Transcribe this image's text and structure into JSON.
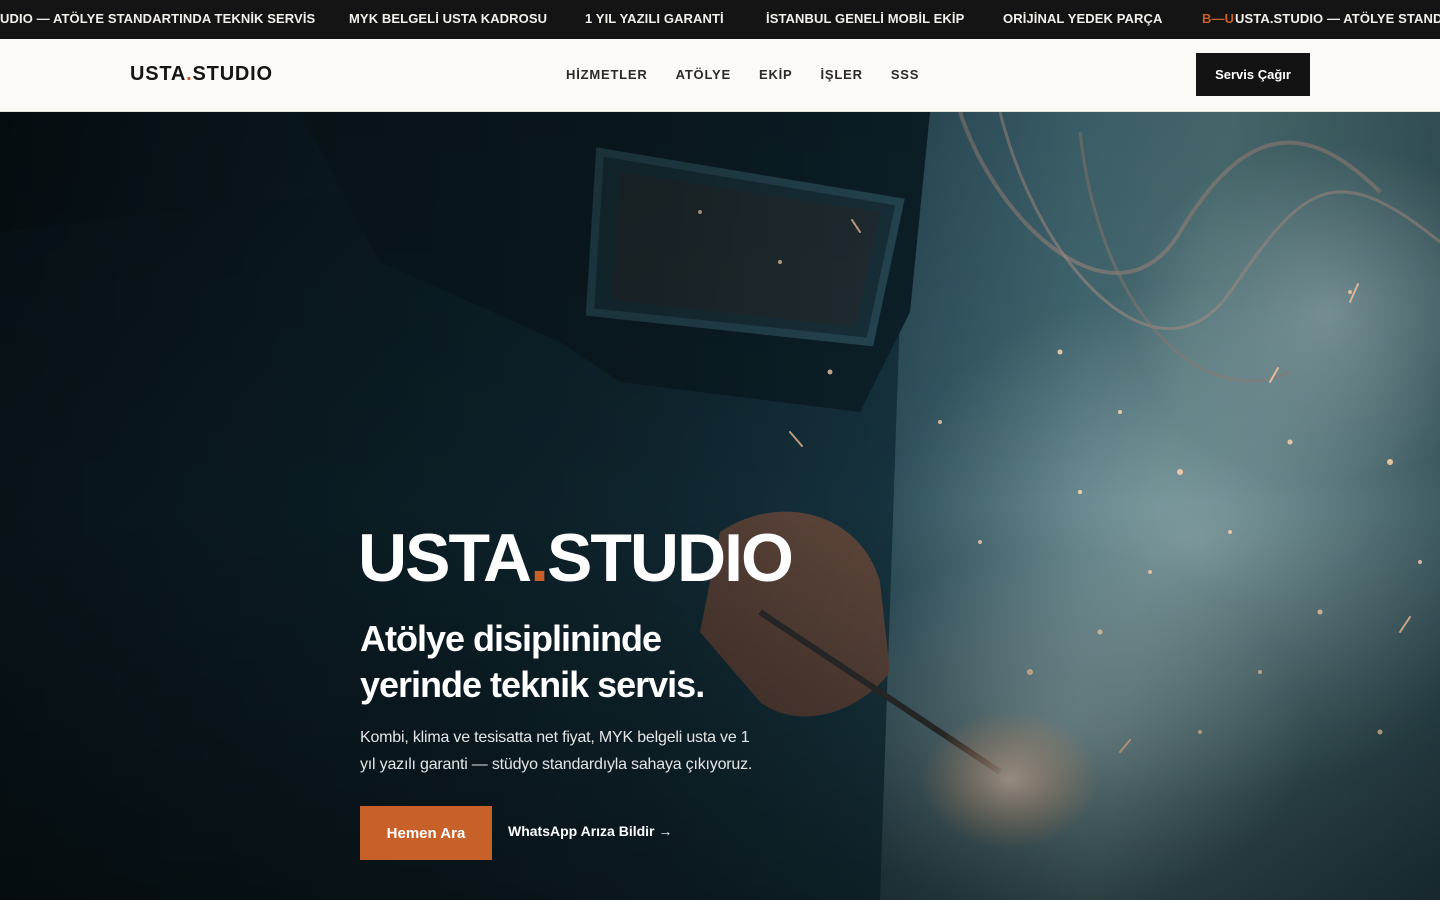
{
  "ticker": {
    "items": [
      "UDIO — ATÖLYE STANDARTINDA TEKNİK SERVİS",
      "MYK BELGELİ USTA KADROSU",
      "1 YIL YAZILI GARANTİ",
      "İSTANBUL GENELİ MOBİL EKİP",
      "ORİJİNAL YEDEK PARÇA"
    ],
    "accent_mark": "B—U",
    "last_item": "USTA.STUDIO — ATÖLYE STANDA"
  },
  "header": {
    "logo_text": "USTA",
    "logo_dot": ".",
    "logo_text2": "STUDIO",
    "nav": [
      "HİZMETLER",
      "ATÖLYE",
      "EKİP",
      "İŞLER",
      "SSS"
    ],
    "cta_label": "Servis Çağır"
  },
  "hero": {
    "title_part1": "USTA",
    "title_dot": ".",
    "title_part2": "STUDIO",
    "subtitle_line1": "Atölye disiplininde",
    "subtitle_line2": "yerinde teknik servis.",
    "desc_line1": "Kombi, klima ve tesisatta net fiyat, MYK belgeli usta ve 1",
    "desc_line2": "yıl yazılı garanti — stüdyo standardıyla sahaya çıkıyoruz.",
    "primary_button": "Hemen Ara",
    "secondary_link": "WhatsApp Arıza Bildir →"
  },
  "colors": {
    "accent": "#c8602a",
    "dark": "#131313",
    "header_bg": "#fbfaf6"
  },
  "background_image": "welder-with-mask-and-sparks"
}
